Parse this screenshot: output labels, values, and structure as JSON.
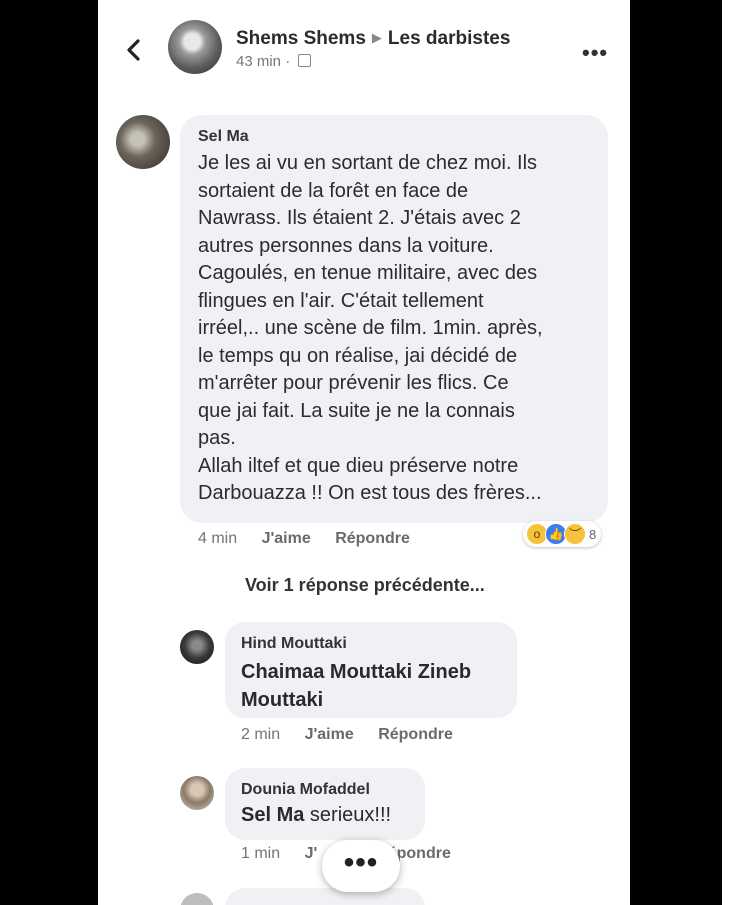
{
  "header": {
    "author": "Shems Shems",
    "group": "Les darbistes",
    "time": "43 min",
    "separator": "·"
  },
  "comments": [
    {
      "author": "Sel Ma",
      "text": "Je les ai vu en sortant de chez moi. Ils\nsortaient de la forêt en face de\nNawrass. Ils étaient 2. J'étais avec 2\nautres personnes dans la voiture.\nCagoulés, en tenue militaire, avec des\nflingues en l'air. C'était tellement\nirréel,.. une scène de film. 1min. après,\nle temps qu on réalise, jai décidé de\nm'arrêter pour prévenir les flics. Ce\nque jai fait. La suite je ne la connais\npas.\nAllah iltef et que dieu préserve notre\nDarbouazza !! On est tous des frères...",
      "time": "4 min",
      "like": "J'aime",
      "reply": "Répondre",
      "reaction_count": "8",
      "reactions": [
        "wow-reaction-icon",
        "like-reaction-icon",
        "sad-reaction-icon"
      ]
    }
  ],
  "previous_replies": "Voir 1 réponse précédente...",
  "replies": [
    {
      "author": "Hind Mouttaki",
      "text": "Chaimaa Mouttaki Zineb\nMouttaki",
      "time": "2 min",
      "like": "J'aime",
      "reply": "Répondre"
    },
    {
      "author": "Dounia Mofaddel",
      "text_bold": "Sel Ma",
      "text_rest": " serieux!!!",
      "time": "1 min",
      "like_partial": "J'",
      "reply_partial": "épondre"
    }
  ],
  "fab_icon": "more-horizontal-icon",
  "fab_label": "•••"
}
